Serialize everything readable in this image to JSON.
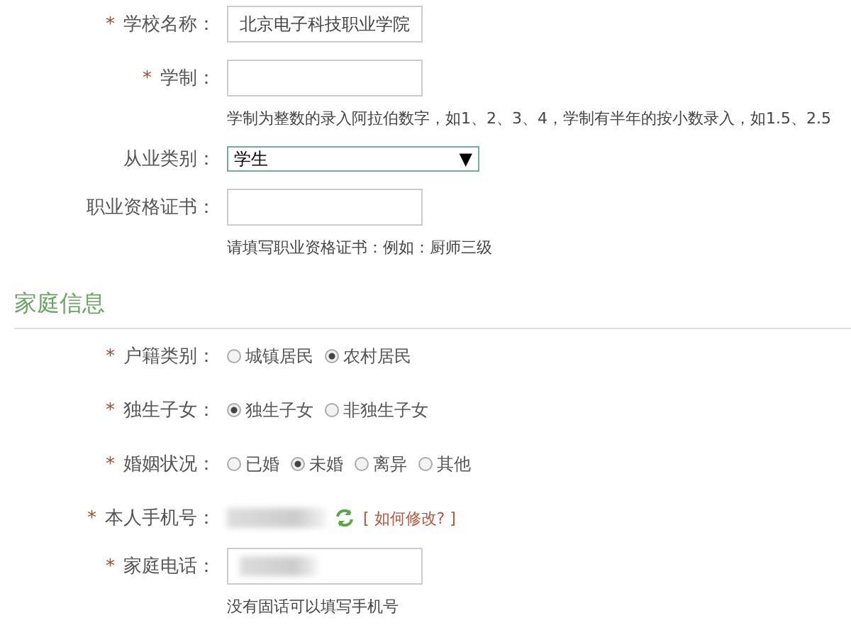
{
  "sections": [
    {
      "rows": [
        {
          "kind": "text",
          "mark": "*",
          "label": "学校名称：",
          "value": "北京电子科技职业学院"
        },
        {
          "kind": "text",
          "mark": "*",
          "label": "学制：",
          "value": "",
          "hint": "学制为整数的录入阿拉伯数字，如1、2、3、4，学制有半年的按小数录入，如1.5、2.5"
        },
        {
          "kind": "select",
          "label": "从业类别：",
          "value": "学生",
          "arrow": "▼"
        },
        {
          "kind": "text",
          "label": "职业资格证书：",
          "value": "",
          "hint": "请填写职业资格证书：例如：厨师三级"
        }
      ]
    },
    {
      "title": "家庭信息",
      "rows": [
        {
          "kind": "radio",
          "mark": "*",
          "label": "户籍类别：",
          "options": [
            {
              "label": "城镇居民",
              "selected": false
            },
            {
              "label": "农村居民",
              "selected": true
            }
          ]
        },
        {
          "kind": "radio",
          "mark": "*",
          "label": "独生子女：",
          "options": [
            {
              "label": "独生子女",
              "selected": true
            },
            {
              "label": "非独生子女",
              "selected": false
            }
          ]
        },
        {
          "kind": "radio",
          "mark": "*",
          "label": "婚姻状况：",
          "options": [
            {
              "label": "已婚",
              "selected": false
            },
            {
              "label": "未婚",
              "selected": true
            },
            {
              "label": "离异",
              "selected": false
            },
            {
              "label": "其他",
              "selected": false
            }
          ]
        },
        {
          "kind": "phone",
          "mark": "*",
          "label": "本人手机号：",
          "link": "[ 如何修改? ]"
        },
        {
          "kind": "blurred-input",
          "mark": "*",
          "label": "家庭电话：",
          "hint": "没有固话可以填写手机号"
        }
      ]
    }
  ]
}
